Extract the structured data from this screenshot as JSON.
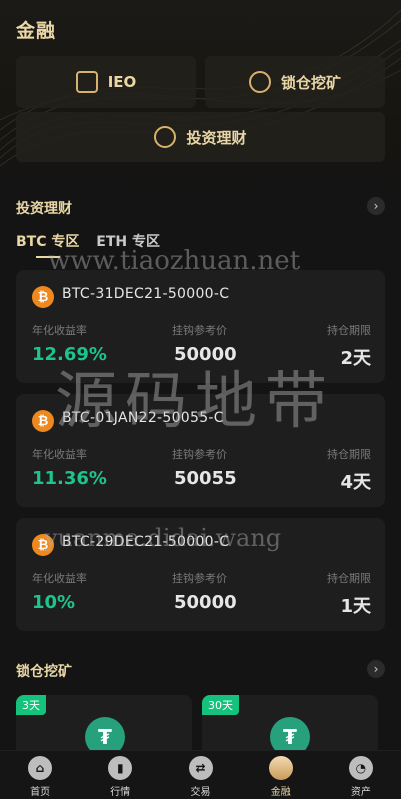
{
  "page": {
    "title": "金融"
  },
  "tiles": [
    {
      "label": "IEO",
      "icon": "document-chart-icon"
    },
    {
      "label": "锁仓挖矿",
      "icon": "coin-hand-icon"
    },
    {
      "label": "投资理财",
      "icon": "target-coin-icon"
    }
  ],
  "invest": {
    "title": "投资理财",
    "tabs": [
      "BTC 专区",
      "ETH 专区"
    ],
    "col_labels": [
      "年化收益率",
      "挂钩参考价",
      "持仓期限"
    ],
    "products": [
      {
        "name": "BTC-31DEC21-50000-C",
        "rate": "12.69%",
        "ref_price": "50000",
        "term": "2天"
      },
      {
        "name": "BTC-01JAN22-50055-C",
        "rate": "11.36%",
        "ref_price": "50055",
        "term": "4天"
      },
      {
        "name": "BTC-29DEC21-50000-C",
        "rate": "10%",
        "ref_price": "50000",
        "term": "1天"
      }
    ]
  },
  "lockmining": {
    "title": "锁仓挖矿",
    "cards": [
      {
        "days": "3天"
      },
      {
        "days": "30天"
      }
    ]
  },
  "watermarks": {
    "url": "www.tiaozhuan.net",
    "cn": "源码地带",
    "url2": "yuanma.didai.wang"
  },
  "nav": [
    {
      "label": "首页",
      "icon": "home-icon",
      "active": false
    },
    {
      "label": "行情",
      "icon": "bar-chart-icon",
      "active": false
    },
    {
      "label": "交易",
      "icon": "exchange-icon",
      "active": false
    },
    {
      "label": "金融",
      "icon": "finance-icon",
      "active": true
    },
    {
      "label": "资产",
      "icon": "pie-chart-icon",
      "active": false
    }
  ],
  "colors": {
    "accent": "#e9d7a5",
    "green": "#1ec48b",
    "btc": "#f0891d",
    "usdt": "#26a17b"
  }
}
